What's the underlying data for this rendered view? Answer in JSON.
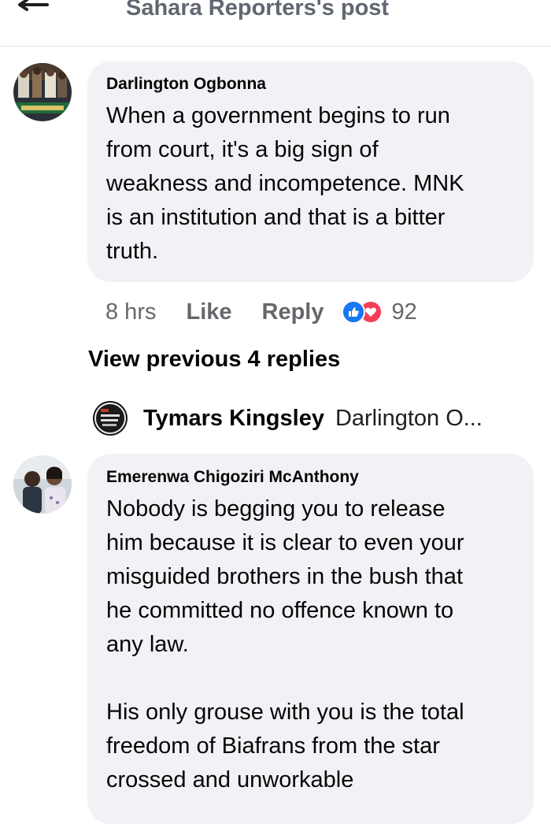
{
  "header": {
    "title": "Sahara Reporters's post",
    "back_icon": "arrow-left-icon"
  },
  "comments": [
    {
      "author": "Darlington Ogbonna",
      "text": "When a government begins to run\nfrom court, it's a big sign of\nweakness and incompetence. MNK\nis an institution and that is a bitter\ntruth.",
      "time": "8 hrs",
      "like_label": "Like",
      "reply_label": "Reply",
      "reaction_count": "92",
      "reactions": [
        "like-reaction-icon",
        "love-reaction-icon"
      ]
    },
    {
      "author": "Emerenwa Chigoziri McAnthony",
      "text": "Nobody is begging you to release\nhim because it is clear to even your\nmisguided brothers in the bush that\nhe committed no offence known to\nany law.\n\nHis only grouse with you is the total\nfreedom of Biafrans from the star\ncrossed and unworkable"
    }
  ],
  "view_previous": "View previous 4 replies",
  "reply_preview": {
    "author": "Tymars Kingsley",
    "snippet": "Darlington O..."
  },
  "colors": {
    "bubble": "#f0f2f5",
    "like_blue": "#1877f2",
    "love_red": "#f33e58",
    "meta_gray": "#65676b"
  }
}
